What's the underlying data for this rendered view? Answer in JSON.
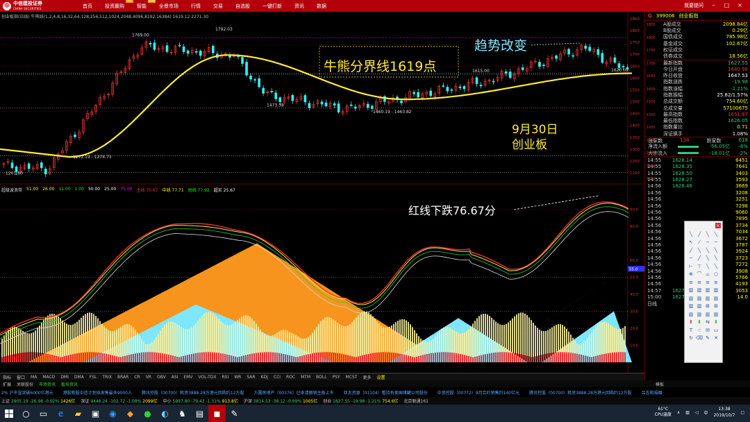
{
  "app": {
    "logo_cn": "中信建投证券",
    "logo_en": "CHINA SECURITIES",
    "menu": [
      {
        "label": "首页",
        "hot": ""
      },
      {
        "label": "投资赢购",
        "hot": "HOT"
      },
      {
        "label": "智能",
        "hot": "NEW"
      },
      {
        "label": "全景市场",
        "hot": ""
      },
      {
        "label": "行情",
        "hot": ""
      },
      {
        "label": "交易",
        "hot": ""
      },
      {
        "label": "自选股",
        "hot": ""
      },
      {
        "label": "一键打新",
        "hot": ""
      },
      {
        "label": "资讯",
        "hot": ""
      },
      {
        "label": "数据",
        "hot": ""
      }
    ],
    "ask_label": "我要提问"
  },
  "chart": {
    "info_line": "创业板指(日线)  牛熊线(1,2,4,8,16,32,64,128,256,512,1024,2048,4096,8192,16384)  1619.12  2271.30",
    "ind_title": "超级波浪带",
    "ind_values": [
      {
        "label": "51.00",
        "color": "#ff0"
      },
      {
        "label": "26.00",
        "color": "#ff0"
      },
      {
        "label": "11.00",
        "color": "#0f0"
      },
      {
        "label": "1.00",
        "color": "#0f0"
      },
      {
        "label": "50.00",
        "color": "#fff"
      },
      {
        "label": "25.00",
        "color": "#fff"
      },
      {
        "label": "75.00",
        "color": "#f0f"
      },
      {
        "label": "主线 70.67",
        "color": "#e33"
      },
      {
        "label": "中线 77.71",
        "color": "#ff0"
      },
      {
        "label": "短线 77.92",
        "color": "#0f0"
      },
      {
        "label": "超买 25.67",
        "color": "#fff"
      }
    ],
    "price_labels": {
      "high": "1792.03",
      "high_mark": "1769.00",
      "p1615": "1615.00",
      "p1620": "1620.00",
      "p1473": "1473.38",
      "low_a": "1460.19 - 1463.82",
      "low_b": "1272.19 - 1274.73",
      "low_c": "1201.80"
    },
    "annotations": {
      "divide": "牛熊分界线1619点",
      "trend": "趋势改变",
      "date": "9月30日",
      "board": "创业板",
      "red": "红线下跌76.67分"
    },
    "y_axis_upper": [
      "1850",
      "1800",
      "1750",
      "1700",
      "1650",
      "1600",
      "1550",
      "1500",
      "1450",
      "1400",
      "1350",
      "1300",
      "1250",
      "1200"
    ],
    "y_axis_lower": [
      "90.0",
      "80.0",
      "60.0",
      "50.0",
      "40.0",
      "30.0",
      "20.0",
      "10.0"
    ],
    "y_badge": "55.0"
  },
  "tabs": {
    "row1": [
      "指标",
      "窗口",
      "MA",
      "MACD",
      "DMI",
      "DMA",
      "FSL",
      "TRIX",
      "BRAR",
      "CR",
      "VR",
      "OBV",
      "ASI",
      "EMV",
      "VOL-TDX",
      "RSI",
      "WR",
      "SAR",
      "KDJ",
      "CCI",
      "ROC",
      "MTM",
      "BOLL",
      "PSY",
      "MCST",
      "更多",
      "设置"
    ],
    "row2": [
      "扩展",
      "关联股份",
      "市场资讯",
      "板块资讯"
    ],
    "right_label": "模板"
  },
  "ticker": [
    "2% 沪市湿突破6000亿港元",
    "港股新股中信计划拟发售最多9000人",
    "腾讯控股（00700）耗资3888.28万港元回购约12万股",
    "方圆房地产（00376）已申请撤销主板上市",
    "亚太资源（01104）看持有美国储罐公司股份",
    "中资控股（00772）9月合约销售约140亿元",
    "腾讯控股（00700）耗资3888.28万港元回购约12万股",
    "吕志和捐赠"
  ],
  "indexbar": [
    {
      "label": "上证",
      "price": "2905.19",
      "chg": "-26.98",
      "pct": "-0.92%",
      "vol": "1426亿"
    },
    {
      "label": "深证",
      "price": "9446.24",
      "chg": "-102.72",
      "pct": "-1.08%",
      "vol": "2099亿"
    },
    {
      "label": "中小",
      "price": "5997.80",
      "chg": "-79.43",
      "pct": "-1.31%",
      "vol": "913.8亿"
    },
    {
      "label": "沪深",
      "price": "3814.53",
      "chg": "-38.12",
      "pct": "-0.99%",
      "vol": "1005亿"
    },
    {
      "label": "创业",
      "price": "1627.55",
      "chg": "-19.98",
      "pct": "-1.21%",
      "vol": "754.6亿"
    }
  ],
  "indexbar_tail": "北京联通161",
  "rpanel": {
    "flag": "G",
    "code": "399006",
    "name": "创业板指",
    "top_rows": [
      {
        "k": "A股成交",
        "v": "2098.84亿",
        "c": "#ff0"
      },
      {
        "k": "B股成交",
        "v": "0.29亿",
        "c": "#ff0"
      },
      {
        "k": "国债成交",
        "v": "785.98亿",
        "c": "#ff0"
      },
      {
        "k": "基金成交",
        "v": "102.67亿",
        "c": "#ff0"
      },
      {
        "k": "权证成交",
        "v": "",
        "c": "#ff0"
      },
      {
        "k": "债券成交",
        "v": "18.56亿",
        "c": "#ff0"
      }
    ],
    "mid_rows": [
      {
        "k": "最新指数",
        "v": "1627.55",
        "c": "#2ecc71"
      },
      {
        "k": "今日开盘",
        "v": "1640.98",
        "c": "#e33"
      },
      {
        "k": "昨日收盘",
        "v": "1647.53",
        "c": "#fff"
      },
      {
        "k": "指数涨跌",
        "v": "-19.98",
        "c": "#2ecc71"
      },
      {
        "k": "指数涨幅",
        "v": "-1.21%",
        "c": "#2ecc71"
      },
      {
        "k": "指数振幅",
        "v": "25.82/1.57%",
        "c": "#fff"
      },
      {
        "k": "总成交额",
        "v": "754.60亿",
        "c": "#ff0"
      },
      {
        "k": "总成交量",
        "v": "57100675",
        "c": "#ff0"
      },
      {
        "k": "最高指数",
        "v": "1651.87",
        "c": "#e33"
      },
      {
        "k": "最低指数",
        "v": "1626.05",
        "c": "#2ecc71"
      },
      {
        "k": "指数量比",
        "v": "0.71",
        "c": "#ff0"
      },
      {
        "k": "深证换手",
        "v": "1.08%",
        "c": "#fff"
      }
    ],
    "updown": {
      "up_label": "涨家数",
      "up": "134",
      "down_label": "跌家数",
      "down": "618"
    },
    "flows": [
      {
        "k": "净流入额",
        "v": "-56.05亿",
        "p": "-8%"
      },
      {
        "k": "大宗流入",
        "v": "-18.01亿",
        "p": "-2%"
      }
    ],
    "scale": [
      "1850",
      "1800",
      "1750",
      "1700",
      "1650",
      "1600",
      "1550",
      "1500",
      "1450",
      "1400",
      "1350",
      "1300",
      "1250"
    ],
    "ticks": [
      {
        "t": "14:55",
        "p": "1628.14",
        "v": "6451"
      },
      {
        "t": "14:55",
        "p": "1628.35",
        "v": "7641"
      },
      {
        "t": "14:55",
        "p": "1628.50",
        "v": "3403"
      },
      {
        "t": "14:55",
        "p": "1628.27",
        "v": "3593"
      },
      {
        "t": "14:56",
        "p": "1628.46",
        "v": "3669"
      },
      {
        "t": "14:56",
        "p": "",
        "v": "3208"
      },
      {
        "t": "14:56",
        "p": "",
        "v": "3251"
      },
      {
        "t": "14:56",
        "p": "",
        "v": "7298"
      },
      {
        "t": "14:56",
        "p": "",
        "v": "9060"
      },
      {
        "t": "14:56",
        "p": "",
        "v": "7895"
      },
      {
        "t": "14:56",
        "p": "",
        "v": "3734"
      },
      {
        "t": "14:56",
        "p": "",
        "v": "7034"
      },
      {
        "t": "14:56",
        "p": "",
        "v": "3672"
      },
      {
        "t": "14:56",
        "p": "",
        "v": "3787"
      },
      {
        "t": "14:56",
        "p": "",
        "v": "3924"
      },
      {
        "t": "14:56",
        "p": "",
        "v": "3723"
      },
      {
        "t": "14:56",
        "p": "",
        "v": "7272"
      },
      {
        "t": "14:56",
        "p": "",
        "v": "3908"
      },
      {
        "t": "14:56",
        "p": "",
        "v": "5766"
      },
      {
        "t": "14:56",
        "p": "",
        "v": "4193"
      },
      {
        "t": "14:57",
        "p": "1627.52",
        "v": "3053"
      },
      {
        "t": "15:00",
        "p": "1627.55",
        "v": "14.0"
      }
    ],
    "bottom_label": "日线"
  },
  "taskbar": {
    "temp": "61°C",
    "cpu": "CPU温度",
    "time": "13:38",
    "date": "2019/10/7",
    "lang": "中"
  },
  "colors": {
    "accent": "#b4000a",
    "up": "#e33",
    "down": "#2ecc71",
    "bull_bear_line": "#ffeb3b"
  }
}
